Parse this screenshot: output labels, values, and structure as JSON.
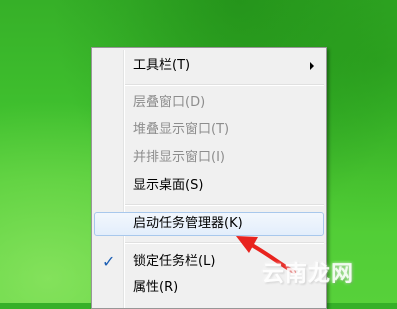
{
  "context_menu": {
    "items": [
      {
        "label": "工具栏(T)",
        "state": "enabled",
        "submenu": true
      },
      {
        "label": "层叠窗口(D)",
        "state": "disabled"
      },
      {
        "label": "堆叠显示窗口(T)",
        "state": "disabled"
      },
      {
        "label": "并排显示窗口(I)",
        "state": "disabled"
      },
      {
        "label": "显示桌面(S)",
        "state": "enabled"
      },
      {
        "label": "启动任务管理器(K)",
        "state": "highlighted"
      },
      {
        "label": "锁定任务栏(L)",
        "state": "enabled",
        "checked": true
      },
      {
        "label": "属性(R)",
        "state": "enabled"
      }
    ],
    "check_mark": "✓"
  },
  "annotation": {
    "arrow_color": "#e8231e"
  },
  "watermark": {
    "text": "云南龙网"
  },
  "colors": {
    "desktop": "#3fbf2e",
    "menu_bg": "#f0f0f0",
    "highlight_border": "#a8c8ec",
    "disabled_text": "#8d8d8d"
  }
}
